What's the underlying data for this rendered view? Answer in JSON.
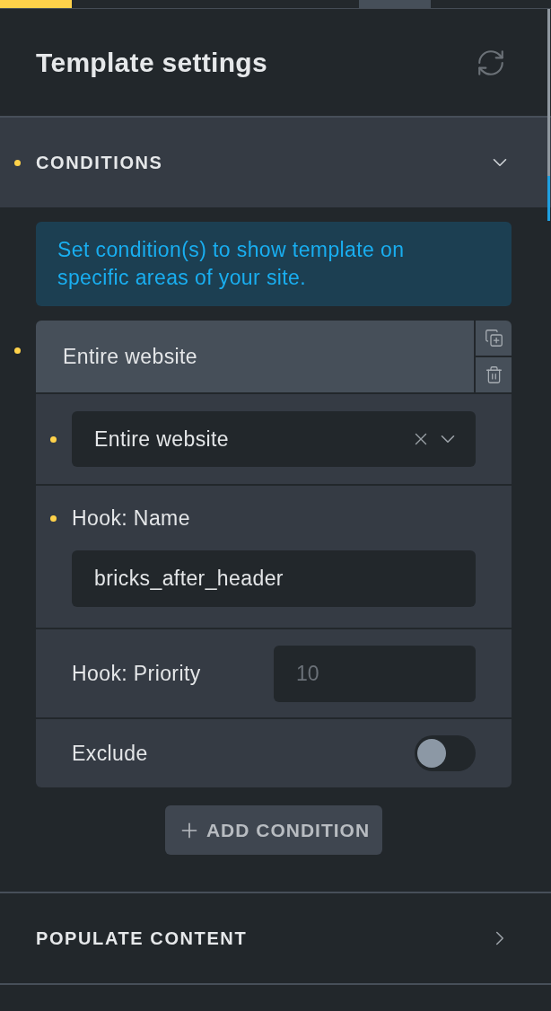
{
  "toolbar_tabs": [
    {
      "selected": true,
      "highlighted": false
    },
    {
      "selected": false,
      "highlighted": false
    },
    {
      "selected": false,
      "highlighted": false
    },
    {
      "selected": false,
      "highlighted": false
    },
    {
      "selected": false,
      "highlighted": false
    },
    {
      "selected": false,
      "highlighted": true
    },
    {
      "selected": false,
      "highlighted": false
    },
    {
      "selected": false,
      "highlighted": false
    }
  ],
  "panel": {
    "title": "Template settings"
  },
  "sections": [
    {
      "title": "CONDITIONS",
      "expanded": true,
      "modified": true,
      "info": "Set condition(s) to show template on specific areas of your site.",
      "conditions": [
        {
          "title": "Entire website",
          "modified": true,
          "fields": [
            {
              "kind": "select",
              "value": "Entire website",
              "modified": true
            },
            {
              "kind": "text",
              "label": "Hook: Name",
              "value": "bricks_after_header",
              "modified": true
            },
            {
              "kind": "number",
              "label": "Hook: Priority",
              "placeholder": "10",
              "modified": false
            },
            {
              "kind": "toggle",
              "label": "Exclude",
              "on": false,
              "modified": false
            }
          ]
        }
      ],
      "add_button": "ADD CONDITION"
    },
    {
      "title": "POPULATE CONTENT",
      "expanded": false,
      "modified": false
    }
  ]
}
